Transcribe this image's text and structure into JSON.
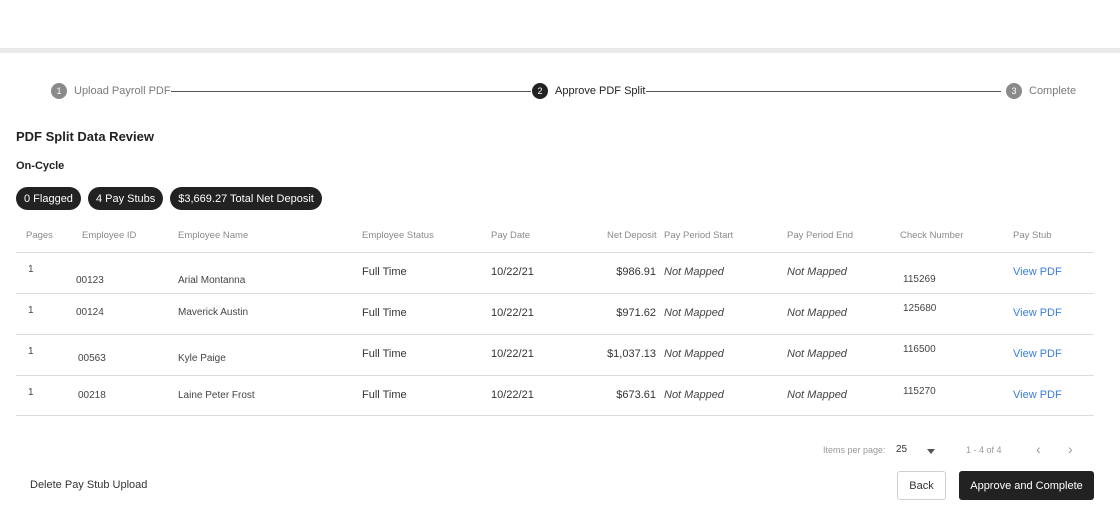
{
  "stepper": {
    "steps": [
      {
        "num": "1",
        "label": "Upload Payroll PDF"
      },
      {
        "num": "2",
        "label": "Approve PDF Split"
      },
      {
        "num": "3",
        "label": "Complete"
      }
    ]
  },
  "page": {
    "title": "PDF Split Data Review",
    "subtitle": "On-Cycle"
  },
  "summary": {
    "flagged": "0 Flagged",
    "pay_stubs": "4 Pay Stubs",
    "total_net": "$3,669.27 Total Net Deposit"
  },
  "table": {
    "headers": [
      "Pages",
      "Employee ID",
      "Employee Name",
      "Employee Status",
      "Pay Date",
      "Net Deposit",
      "Pay Period Start",
      "Pay Period End",
      "Check Number",
      "Pay Stub"
    ],
    "rows": [
      {
        "pages": "1",
        "employee_id": "00123",
        "name": "Arial Montanna",
        "status": "Full Time",
        "pay_date": "10/22/21",
        "net_deposit": "$986.91",
        "period_start": "Not Mapped",
        "period_end": "Not Mapped",
        "check_number": "115269",
        "pay_stub": "View PDF"
      },
      {
        "pages": "1",
        "employee_id": "00124",
        "name": "Maverick Austin",
        "status": "Full Time",
        "pay_date": "10/22/21",
        "net_deposit": "$971.62",
        "period_start": "Not Mapped",
        "period_end": "Not Mapped",
        "check_number": "125680",
        "pay_stub": "View PDF"
      },
      {
        "pages": "1",
        "employee_id": "00563",
        "name": "Kyle Paige",
        "status": "Full Time",
        "pay_date": "10/22/21",
        "net_deposit": "$1,037.13",
        "period_start": "Not Mapped",
        "period_end": "Not Mapped",
        "check_number": "116500",
        "pay_stub": "View PDF"
      },
      {
        "pages": "1",
        "employee_id": "00218",
        "name": "Laine Peter Frost",
        "status": "Full Time",
        "pay_date": "10/22/21",
        "net_deposit": "$673.61",
        "period_start": "Not Mapped",
        "period_end": "Not Mapped",
        "check_number": "115270",
        "pay_stub": "View PDF"
      }
    ]
  },
  "paginator": {
    "items_per_page_label": "Items per page:",
    "items_per_page": "25",
    "range": "1 - 4 of 4",
    "prev_icon": "‹",
    "next_icon": "›"
  },
  "actions": {
    "delete": "Delete Pay Stub Upload",
    "back": "Back",
    "approve": "Approve and Complete"
  },
  "colors": {
    "accent_dark": "#222222",
    "link": "#3b7dd8"
  }
}
